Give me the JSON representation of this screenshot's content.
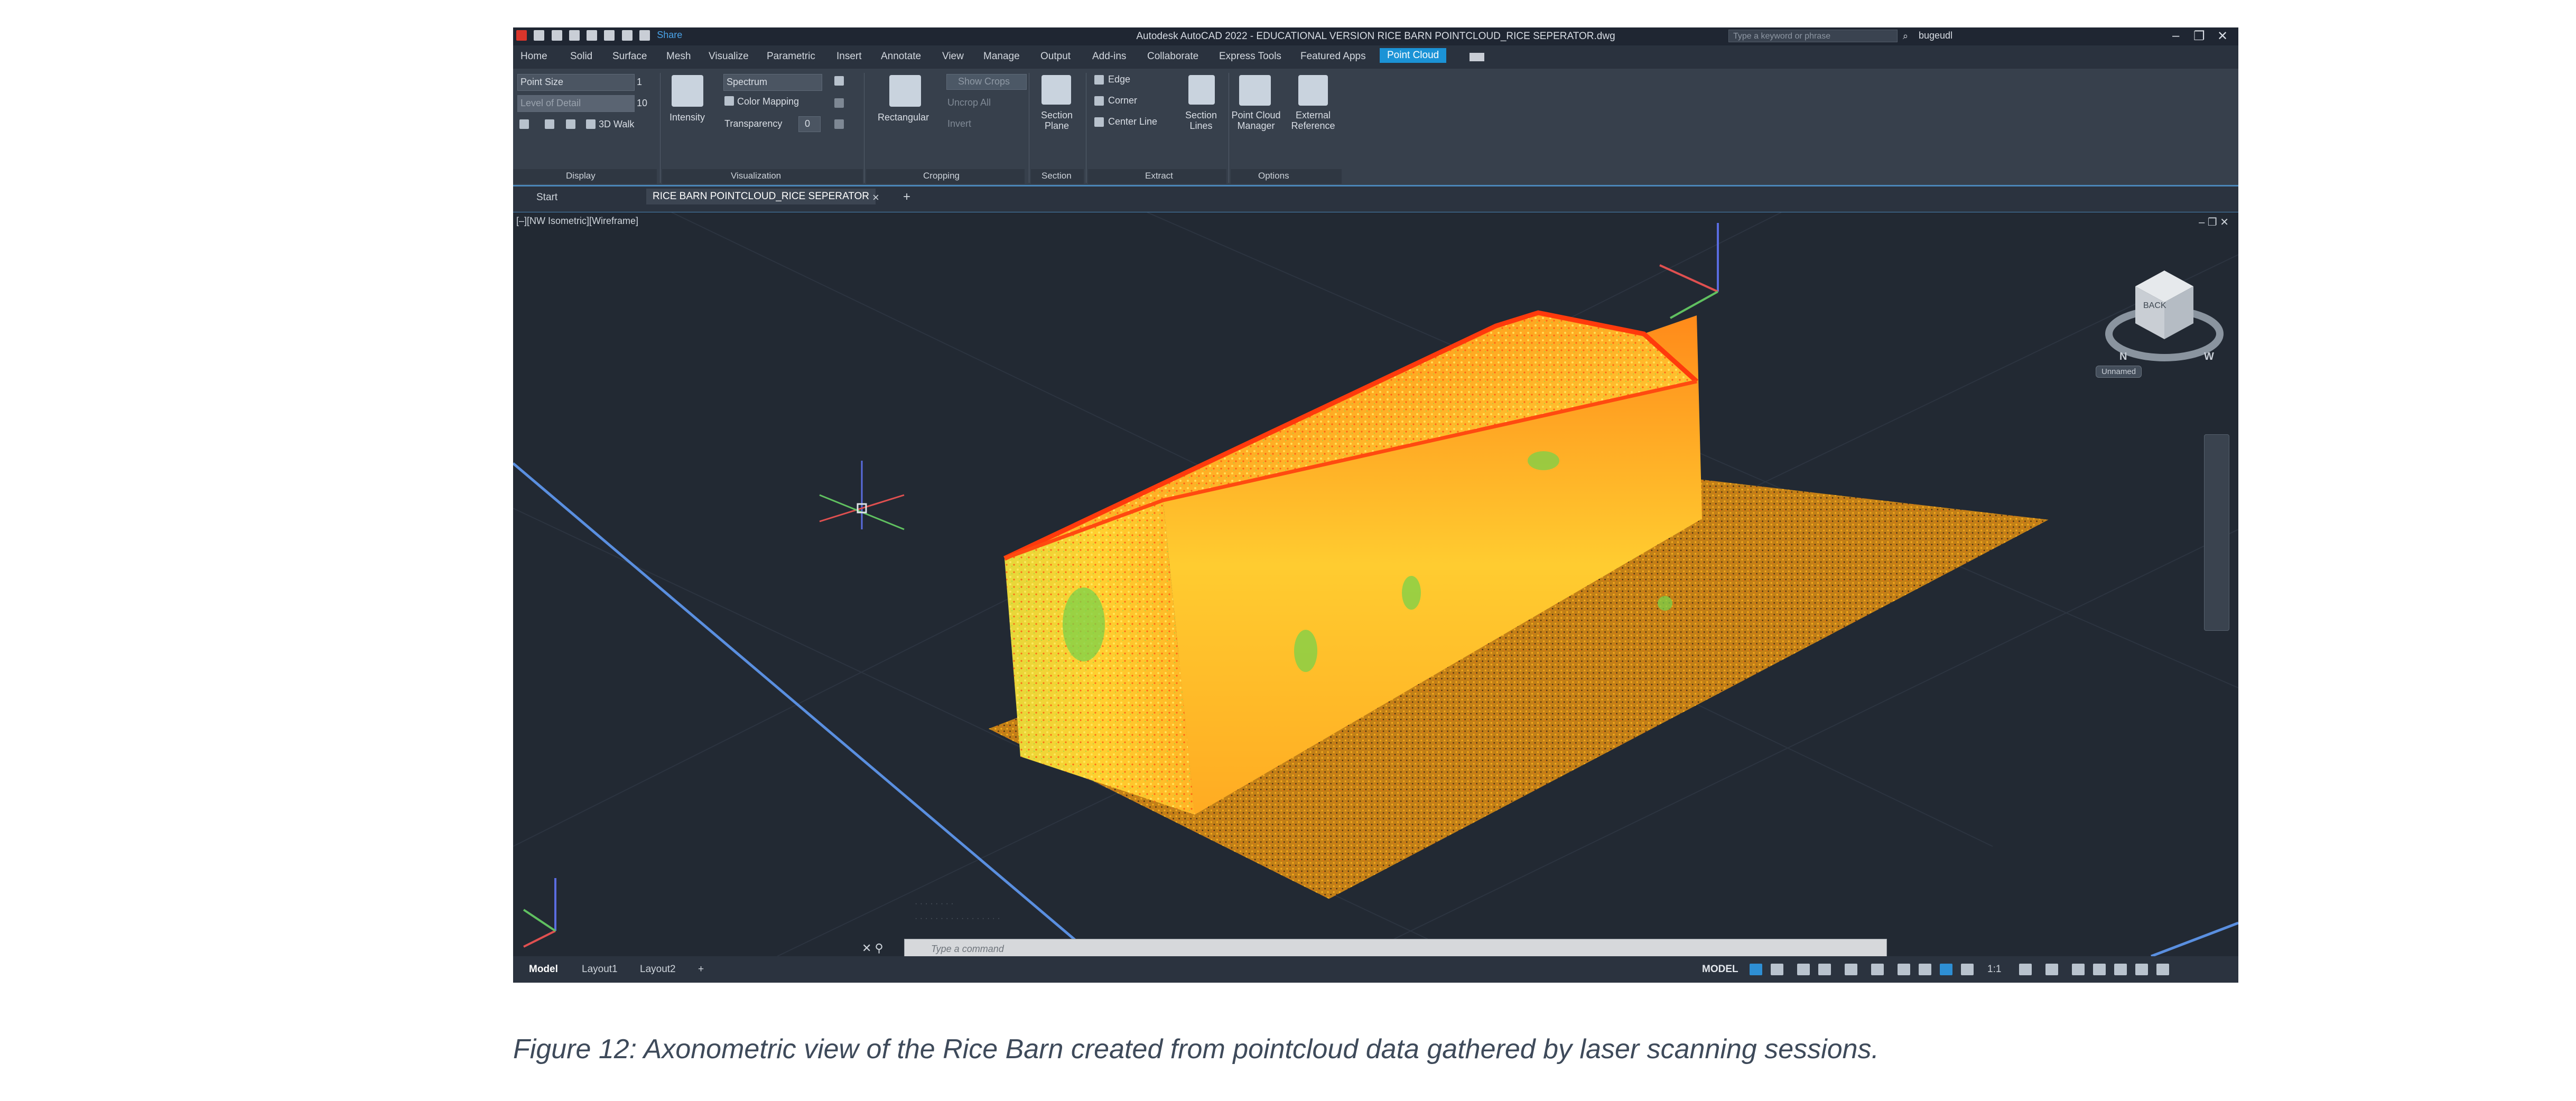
{
  "app": {
    "title": "Autodesk AutoCAD 2022 - EDUCATIONAL VERSION    RICE BARN POINTCLOUD_RICE SEPERATOR.dwg",
    "share_label": "Share",
    "search_placeholder": "Type a keyword or phrase",
    "user_name": "bugeudl",
    "window_controls": [
      "–",
      "❐",
      "✕"
    ]
  },
  "ribbon_tabs": [
    "Home",
    "Solid",
    "Surface",
    "Mesh",
    "Visualize",
    "Parametric",
    "Insert",
    "Annotate",
    "View",
    "Manage",
    "Output",
    "Add-ins",
    "Collaborate",
    "Express Tools",
    "Featured Apps",
    "Point Cloud"
  ],
  "active_ribbon_tab": "Point Cloud",
  "ribbon": {
    "display": {
      "label": "Display",
      "point_size_label": "Point Size",
      "point_size_value": "1",
      "level_of_detail_label": "Level of Detail",
      "level_of_detail_value": "10",
      "walk_label": "3D Walk"
    },
    "visualization": {
      "label": "Visualization",
      "intensity_label": "Intensity",
      "colormap_value": "Spectrum",
      "color_mapping_label": "Color Mapping",
      "transparency_label": "Transparency",
      "transparency_value": "0"
    },
    "cropping": {
      "label": "Cropping",
      "rectangular_label": "Rectangular",
      "show_crop_label": "Show Crops",
      "uncrop_label": "Uncrop All",
      "invert_label": "Invert"
    },
    "section": {
      "label": "Section",
      "section_plane_label": "Section Plane"
    },
    "extract": {
      "label": "Extract",
      "edge_label": "Edge",
      "corner_label": "Corner",
      "center_line_label": "Center Line",
      "section_lines_label": "Section Lines"
    },
    "options": {
      "label": "Options",
      "manager_label": "Point Cloud Manager",
      "external_ref_label": "External Reference"
    }
  },
  "doc_tabs": [
    "Start",
    "RICE BARN POINTCLOUD_RICE SEPERATOR"
  ],
  "active_doc_tab": "RICE BARN POINTCLOUD_RICE SEPERATOR",
  "viewport": {
    "label": "[–][NW Isometric][Wireframe]",
    "view_cube_face": "BACK",
    "compass": [
      "N",
      "W"
    ],
    "wcs_label": "Unnamed",
    "command_placeholder": "Type a command",
    "colors": {
      "background": "#222933",
      "points_high": "#ff5a14",
      "points_mid": "#ffb020",
      "points_low": "#e8f040",
      "points_green": "#6ccf48"
    }
  },
  "status": {
    "layout_tabs": [
      "Model",
      "Layout1",
      "Layout2"
    ],
    "active_layout": "Model",
    "model_label": "MODEL",
    "scale_label": "1:1"
  },
  "caption": "Figure 12: Axonometric view of the Rice Barn created from pointcloud data gathered by laser scanning sessions."
}
